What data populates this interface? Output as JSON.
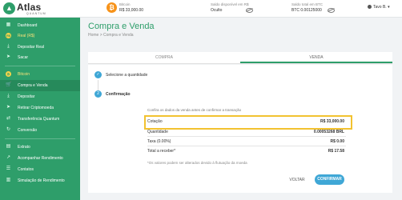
{
  "brand": {
    "name": "Atlas",
    "tagline": "QUANTUM"
  },
  "topbar": {
    "bitcoin_label": "Bitcoin",
    "bitcoin_value": "R$ 33,000.00",
    "brl_label": "Saldo disponível em R$",
    "brl_value": "Oculto",
    "btc_label": "Saldo total em BTC",
    "btc_value": "BTC 0.00125000",
    "user": "Tavo B."
  },
  "sidebar": {
    "items": [
      {
        "label": "Dashboard",
        "icon": "grid-icon"
      },
      {
        "label": "Real (R$)",
        "icon": "real-coin-icon"
      },
      {
        "label": "Depositar Real",
        "icon": "deposit-icon"
      },
      {
        "label": "Sacar",
        "icon": "send-icon"
      },
      {
        "label": "Bitcoin",
        "icon": "bitcoin-coin-icon"
      },
      {
        "label": "Compra e Venda",
        "icon": "cart-icon"
      },
      {
        "label": "Depositar",
        "icon": "download-icon"
      },
      {
        "label": "Retirar Criptomoeda",
        "icon": "send-icon"
      },
      {
        "label": "Transferência Quantum",
        "icon": "transfer-icon"
      },
      {
        "label": "Conversão",
        "icon": "refresh-icon"
      },
      {
        "label": "Extrato",
        "icon": "statement-icon"
      },
      {
        "label": "Acompanhar Rendimento",
        "icon": "chart-icon"
      },
      {
        "label": "Contatos",
        "icon": "contacts-icon"
      },
      {
        "label": "Simulação de Rendimento",
        "icon": "calculator-icon"
      }
    ]
  },
  "page": {
    "title": "Compra e Venda",
    "breadcrumb": "Home  >  Compra e Venda",
    "tabs": [
      "COMPRA",
      "VENDA"
    ],
    "active_tab": "VENDA"
  },
  "steps": [
    {
      "number": "✓",
      "label": "Selecione a quantidade"
    },
    {
      "number": "2",
      "label": "Confirmação"
    }
  ],
  "confirmation": {
    "instruction": "Confira os dados da venda antes de confirmar a transação",
    "rows": [
      {
        "label": "Cotação",
        "value": "R$ 33,000.00"
      },
      {
        "label": "Quantidade",
        "value": "0.00053268 BRL"
      },
      {
        "label": "Taxa (0.00%)",
        "value": "R$ 0.00"
      },
      {
        "label": "Total a receber*",
        "value": "R$ 17.58"
      }
    ],
    "note": "*Os valores podem ser alterados devido à flutuação da moeda",
    "back_label": "VOLTAR",
    "confirm_label": "CONFIRMAR"
  },
  "colors": {
    "primary": "#2e9e6a",
    "accent": "#3fa7d6",
    "highlight": "#f2c230",
    "bitcoin": "#f7931a"
  }
}
